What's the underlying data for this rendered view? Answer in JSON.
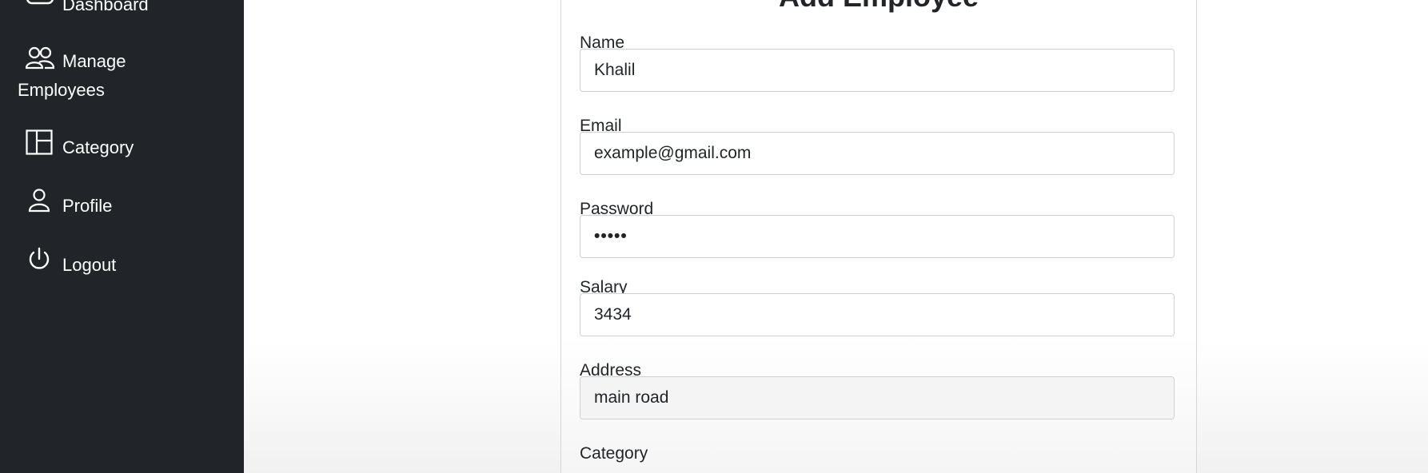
{
  "sidebar": {
    "items": [
      {
        "label": "Dashboard",
        "icon": "dashboard-icon"
      },
      {
        "label_line1": "Manage",
        "label_line2": "Employees",
        "icon": "people-icon"
      },
      {
        "label": "Category",
        "icon": "columns-icon"
      },
      {
        "label": "Profile",
        "icon": "person-icon"
      },
      {
        "label": "Logout",
        "icon": "power-icon"
      }
    ]
  },
  "form": {
    "title": "Add Employee",
    "fields": [
      {
        "label": "Name",
        "value": "Khalil"
      },
      {
        "label": "Email",
        "value": "example@gmail.com"
      },
      {
        "label": "Password",
        "value": "•••••"
      },
      {
        "label": "Salary",
        "value": "3434"
      },
      {
        "label": "Address",
        "value": "main road"
      },
      {
        "label": "Category"
      }
    ]
  },
  "colors": {
    "sidebar_bg": "#212529",
    "text": "#212529",
    "border": "#d0d0d0"
  }
}
